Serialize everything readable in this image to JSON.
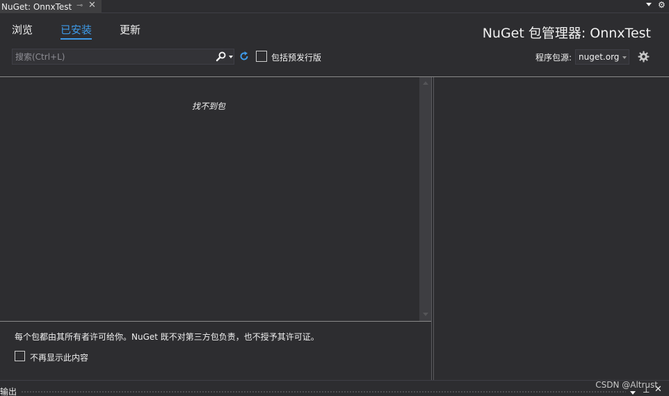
{
  "document_tab": {
    "title": "NuGet: OnnxTest",
    "pin_icon": "pin-icon",
    "close_icon": "close-icon"
  },
  "header": {
    "tabs": [
      {
        "label": "浏览",
        "active": false
      },
      {
        "label": "已安装",
        "active": true
      },
      {
        "label": "更新",
        "active": false
      }
    ],
    "title": "NuGet 包管理器: OnnxTest"
  },
  "toolbar": {
    "search_placeholder": "搜索(Ctrl+L)",
    "search_value": "",
    "include_prerelease_label": "包括预发行版",
    "include_prerelease_checked": false,
    "package_source_label": "程序包源:",
    "package_source_value": "nuget.org"
  },
  "package_list": {
    "empty_message": "找不到包",
    "items": []
  },
  "footer": {
    "disclaimer": "每个包都由其所有者许可给你。NuGet 既不对第三方包负责，也不授予其许可证。",
    "dont_show_label": "不再显示此内容",
    "dont_show_checked": false
  },
  "output_panel": {
    "title": "输出"
  },
  "watermark": "CSDN @Altrust",
  "colors": {
    "background": "#2d2d30",
    "accent": "#3e9be9",
    "text": "#f1f1f1"
  }
}
